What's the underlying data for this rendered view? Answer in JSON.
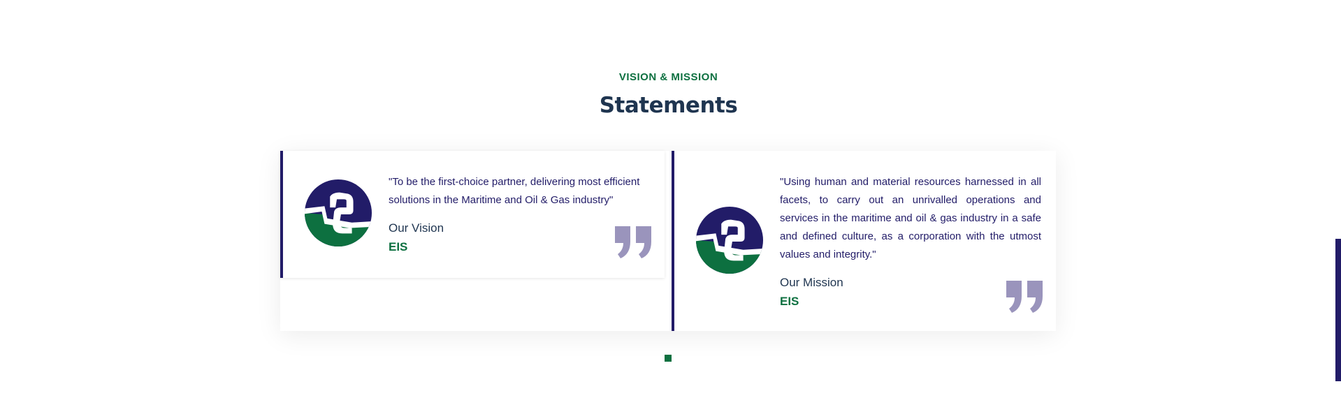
{
  "section": {
    "eyebrow": "VISION & MISSION",
    "title": "Statements"
  },
  "cards": [
    {
      "quote": "\"To be the first-choice partner, delivering most efficient solutions in the Maritime and Oil & Gas industry\"",
      "label": "Our Vision",
      "org": "EIS"
    },
    {
      "quote": "\"Using human and material resources harnessed in all facets, to carry out an unrivalled operations and services in the maritime and oil & gas industry in a safe and defined culture, as a corporation with the utmost values and integrity.\"",
      "label": "Our Mission",
      "org": "EIS"
    }
  ],
  "icons": {
    "logo": "eis-logo-icon",
    "quote": "quote-mark-icon"
  },
  "carousel": {
    "active_index": 1,
    "count": 1
  },
  "colors": {
    "brand_navy": "#221c68",
    "brand_green": "#0d7040",
    "heading": "#1f3550",
    "quote_icon": "#9a94bc"
  }
}
